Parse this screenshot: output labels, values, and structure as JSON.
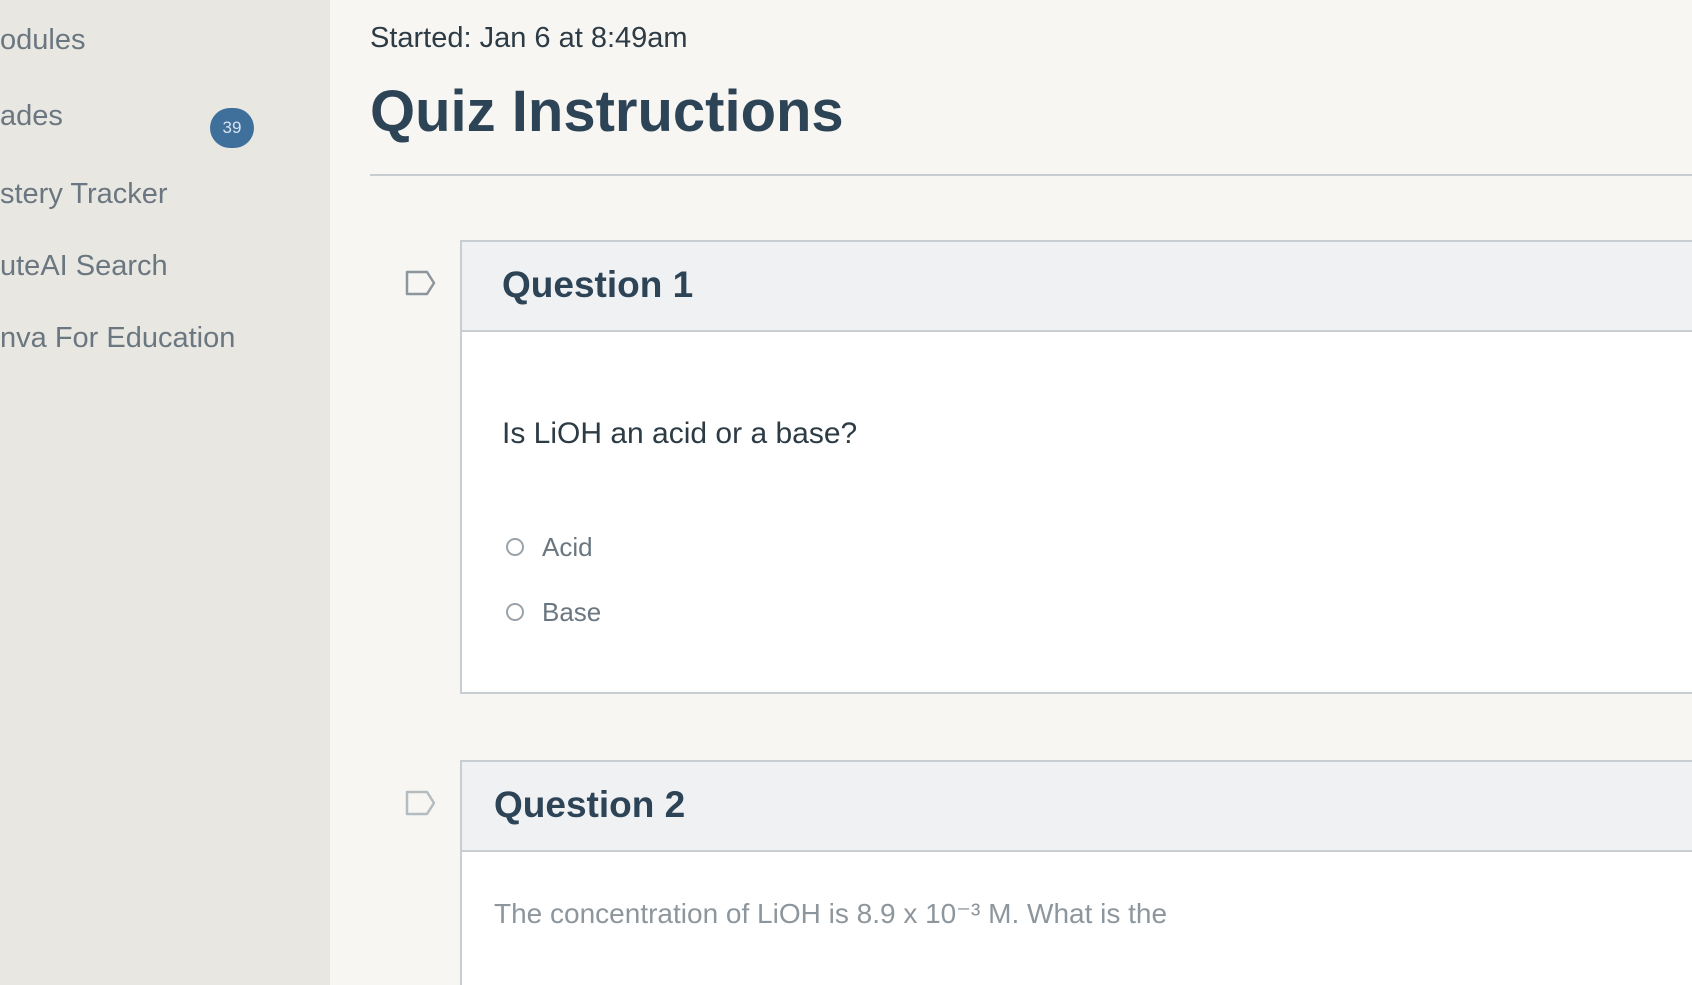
{
  "course_nav": {
    "items": [
      {
        "label": "odules"
      },
      {
        "label": "ades"
      },
      {
        "label": "stery Tracker"
      },
      {
        "label": "uteAI Search"
      },
      {
        "label": "nva For Education"
      }
    ],
    "grades_badge": "39"
  },
  "quiz": {
    "started": "Started: Jan 6 at 8:49am",
    "title": "Quiz Instructions"
  },
  "questions": [
    {
      "title": "Question 1",
      "text": "Is LiOH an acid or a base?",
      "answers": [
        "Acid",
        "Base"
      ]
    },
    {
      "title": "Question 2",
      "text": "The concentration of LiOH is 8.9 x 10⁻³ M. What is the"
    }
  ],
  "colors": {
    "heading": "#2d4356",
    "badge": "#3f6f9b",
    "divider": "#c7cdd1"
  },
  "icons": {
    "flag": "flag-icon"
  }
}
